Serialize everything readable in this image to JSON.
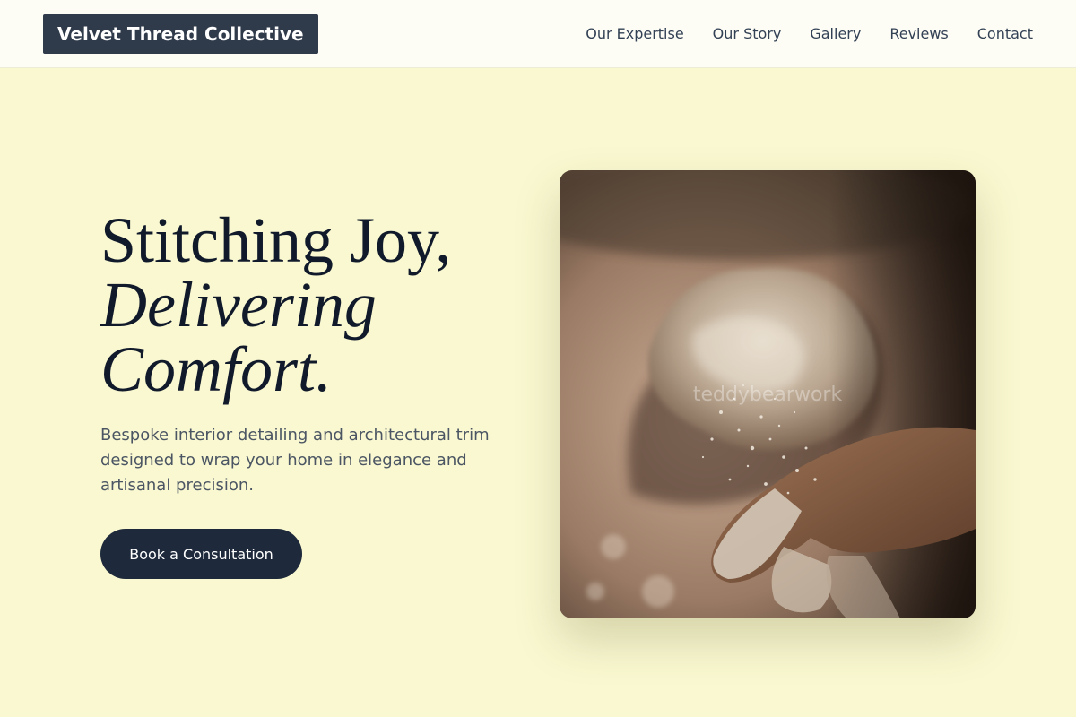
{
  "brand": {
    "name": "Velvet Thread Collective"
  },
  "nav": {
    "items": [
      "Our Expertise",
      "Our Story",
      "Gallery",
      "Reviews",
      "Contact"
    ]
  },
  "hero": {
    "headline_line1": "Stitching Joy,",
    "headline_line2": "Delivering",
    "headline_line3": "Comfort.",
    "description": "Bespoke interior detailing and architectural trim designed to wrap your home in elegance and artisanal precision.",
    "cta_label": "Book a Consultation"
  },
  "image": {
    "watermark": "teddybearwork",
    "subject": "flour-dusted hand over dough"
  },
  "colors": {
    "background": "#f9f8d0",
    "header": "#fefdf5",
    "logo_bg": "#2f3a4a",
    "cta_bg": "#1e293b",
    "headline": "#111a2b"
  }
}
